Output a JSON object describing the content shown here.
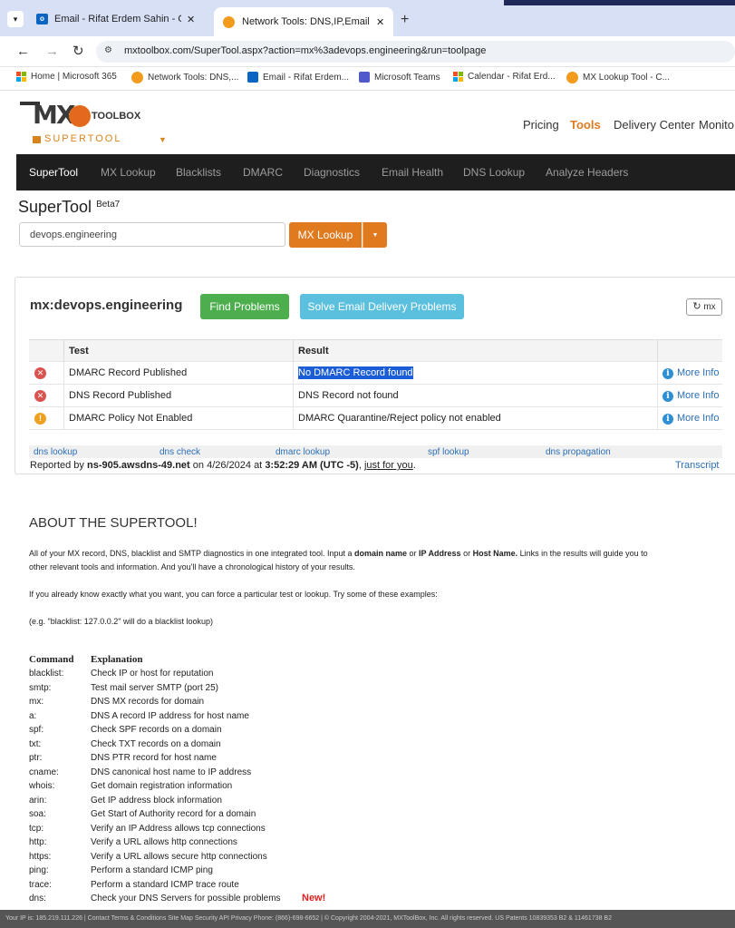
{
  "browser": {
    "tabs": [
      {
        "title": "Email - Rifat Erdem Sahin - Out",
        "active": false
      },
      {
        "title": "Network Tools: DNS,IP,Email",
        "active": true
      }
    ],
    "url": "mxtoolbox.com/SuperTool.aspx?action=mx%3adevops.engineering&run=toolpage",
    "bookmarks": [
      "Home | Microsoft 365",
      "Network Tools: DNS,...",
      "Email - Rifat Erdem...",
      "Microsoft Teams",
      "Calendar - Rifat Erd...",
      "MX Lookup Tool - C..."
    ]
  },
  "site": {
    "logo_text": "TOOLBOX",
    "logo_sub": "SUPERTOOL",
    "topnav": [
      "Pricing",
      "Tools",
      "Delivery Center",
      "Monito"
    ],
    "mainnav": [
      "SuperTool",
      "MX Lookup",
      "Blacklists",
      "DMARC",
      "Diagnostics",
      "Email Health",
      "DNS Lookup",
      "Analyze Headers"
    ]
  },
  "tool": {
    "title": "SuperTool",
    "beta": "Beta7",
    "input_value": "devops.engineering",
    "lookup_button": "MX Lookup"
  },
  "result": {
    "heading": "mx:devops.engineering",
    "find_button": "Find Problems",
    "solve_button": "Solve Email Delivery Problems",
    "refresh_label": "mx",
    "col_test": "Test",
    "col_result": "Result",
    "rows": [
      {
        "status": "error",
        "test": "DMARC Record Published",
        "result": "No DMARC Record found",
        "info": "More Info"
      },
      {
        "status": "error",
        "test": "DNS Record Published",
        "result": "DNS Record not found",
        "info": "More Info"
      },
      {
        "status": "warning",
        "test": "DMARC Policy Not Enabled",
        "result": "DMARC Quarantine/Reject policy not enabled",
        "info": "More Info"
      }
    ],
    "links": [
      "dns lookup",
      "dns check",
      "dmarc lookup",
      "spf lookup",
      "dns propagation"
    ],
    "reported_prefix": "Reported by",
    "reported_server": "ns-905.awsdns-49.net",
    "reported_on": "on 4/26/2024 at",
    "reported_time": "3:52:29 AM (UTC -5)",
    "reported_link": "just for you",
    "transcript": "Transcript"
  },
  "about": {
    "heading": "ABOUT THE SUPERTOOL!",
    "p1a": "All of your MX record, DNS, blacklist and SMTP diagnostics in one integrated tool.  Input a ",
    "p1b": "domain name",
    "p1c": " or ",
    "p1d": "IP Address",
    "p1e": " or ",
    "p1f": "Host Name.",
    "p1g": " Links in the results will guide you to",
    "p1h": "other relevant tools and information.  And you'll have a chronological history of your results.",
    "p2": "If you already know exactly what you want, you can force a particular test or lookup.  Try some of these examples:",
    "p3": "(e.g. \"blacklist: 127.0.0.2\" will do a blacklist lookup)",
    "cmd_header": "Command",
    "exp_header": "Explanation",
    "commands": [
      {
        "cmd": "blacklist:",
        "exp": "Check IP or host for reputation"
      },
      {
        "cmd": "smtp:",
        "exp": "Test mail server SMTP (port 25)"
      },
      {
        "cmd": "mx:",
        "exp": "DNS MX records for domain"
      },
      {
        "cmd": "a:",
        "exp": "DNS A record IP address for host name"
      },
      {
        "cmd": "spf:",
        "exp": "Check SPF records on a domain"
      },
      {
        "cmd": "txt:",
        "exp": "Check TXT records on a domain"
      },
      {
        "cmd": "ptr:",
        "exp": "DNS PTR record for host name"
      },
      {
        "cmd": "cname:",
        "exp": "DNS canonical host name to IP address"
      },
      {
        "cmd": "whois:",
        "exp": "Get domain registration information"
      },
      {
        "cmd": "arin:",
        "exp": "Get IP address block information"
      },
      {
        "cmd": "soa:",
        "exp": "Get Start of Authority record for a domain"
      },
      {
        "cmd": "tcp:",
        "exp": "Verify an IP Address allows tcp connections"
      },
      {
        "cmd": "http:",
        "exp": "Verify a URL allows http connections"
      },
      {
        "cmd": "https:",
        "exp": "Verify a URL allows secure http connections"
      },
      {
        "cmd": "ping:",
        "exp": "Perform a standard ICMP ping"
      },
      {
        "cmd": "trace:",
        "exp": "Perform a standard ICMP trace route"
      },
      {
        "cmd": "dns:",
        "exp": "Check your DNS Servers for possible problems"
      }
    ],
    "new_badge": "New!"
  },
  "footer": {
    "text": "Your IP is: 185.219.111.226 | Contact Terms & Conditions Site Map Security API Privacy Phone: (866)-698-6652 | © Copyright 2004-2021, MXToolBox, Inc. All rights reserved. US Patents 10839353 B2 & 11461738 B2"
  },
  "colors": {
    "accent_orange": "#e07a1f",
    "find_green": "#4cae4c",
    "solve_blue": "#5bc0de",
    "error_red": "#d9534f",
    "warning_orange": "#f0a020",
    "nav_dark": "#1e1e1e"
  }
}
